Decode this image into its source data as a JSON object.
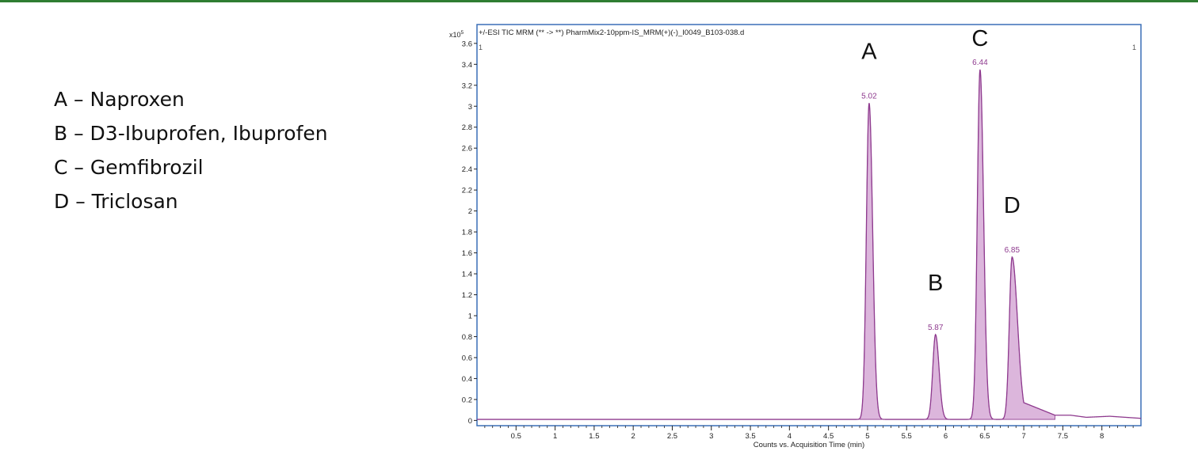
{
  "colors": {
    "top_bar": "#2f7d32",
    "frame": "#3a6fb7",
    "trace": "#8e3a8e",
    "fill": "#dcb6dc",
    "label": "#8e3a8e",
    "axis": "#222222"
  },
  "legend": [
    "A – Naproxen",
    "B – D3-Ibuprofen, Ibuprofen",
    "C – Gemfibrozil",
    "D – Triclosan"
  ],
  "chart_data": {
    "type": "line",
    "title": "+/-ESI TIC MRM (** -> **) PharmMix2-10ppm-IS_MRM(+)(-)_I0049_B103-038.d",
    "corner_labels": {
      "left": "1",
      "right": "1"
    },
    "y_multiplier": "x10",
    "y_multiplier_exp": "5",
    "xlabel": "Counts vs. Acquisition Time (min)",
    "ylabel": "",
    "xlim": [
      0,
      8.5
    ],
    "ylim": [
      -0.05,
      3.78
    ],
    "x_ticks": [
      "0.5",
      "1",
      "1.5",
      "2",
      "2.5",
      "3",
      "3.5",
      "4",
      "4.5",
      "5",
      "5.5",
      "6",
      "6.5",
      "7",
      "7.5",
      "8"
    ],
    "y_ticks": [
      "0",
      "0.2",
      "0.4",
      "0.6",
      "0.8",
      "1",
      "1.2",
      "1.4",
      "1.6",
      "1.8",
      "2",
      "2.2",
      "2.4",
      "2.6",
      "2.8",
      "3",
      "3.2",
      "3.4",
      "3.6"
    ],
    "baseline": 0.01,
    "peaks": [
      {
        "letter": "A",
        "time": 5.02,
        "time_label": "5.02",
        "height": 3.03
      },
      {
        "letter": "B",
        "time": 5.87,
        "time_label": "5.87",
        "height": 0.82
      },
      {
        "letter": "C",
        "time": 6.44,
        "time_label": "6.44",
        "height": 3.35
      },
      {
        "letter": "D",
        "time": 6.85,
        "time_label": "6.85",
        "height": 1.56
      }
    ],
    "tail": [
      {
        "x": 7.4,
        "y": 0.05
      },
      {
        "x": 7.6,
        "y": 0.05
      },
      {
        "x": 7.8,
        "y": 0.03
      },
      {
        "x": 8.1,
        "y": 0.04
      },
      {
        "x": 8.3,
        "y": 0.03
      },
      {
        "x": 8.5,
        "y": 0.02
      }
    ]
  }
}
